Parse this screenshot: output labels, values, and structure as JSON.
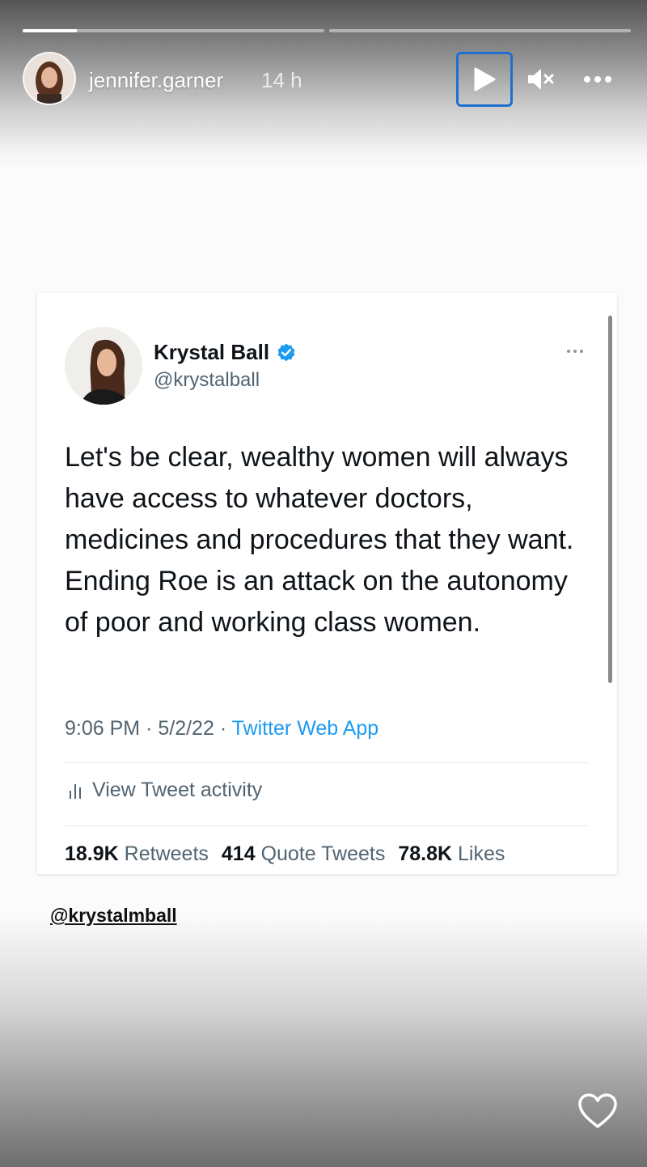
{
  "story": {
    "progress": [
      {
        "fill": 0.18
      },
      {
        "fill": 0
      }
    ],
    "username": "jennifer.garner",
    "time_ago": "14 h",
    "mention": "@krystalmball",
    "icons": {
      "play": "play-icon",
      "mute": "mute-icon",
      "more": "more-icon",
      "like": "heart-icon"
    }
  },
  "tweet": {
    "name": "Krystal Ball",
    "handle": "@krystalball",
    "text": "Let's be clear, wealthy women will always have access to whatever doctors, medicines and procedures that they want. Ending Roe is an attack on the autonomy of poor and working class women.",
    "time": "9:06 PM",
    "date": "5/2/22",
    "separator": "·",
    "source": "Twitter Web App",
    "activity_label": "View Tweet activity",
    "stats": [
      {
        "count": "18.9K",
        "label": "Retweets"
      },
      {
        "count": "414",
        "label": "Quote Tweets"
      },
      {
        "count": "78.8K",
        "label": "Likes"
      }
    ]
  },
  "colors": {
    "link": "#1d9bf0",
    "verified": "#1d9bf0",
    "focus": "#1e6fd0"
  }
}
